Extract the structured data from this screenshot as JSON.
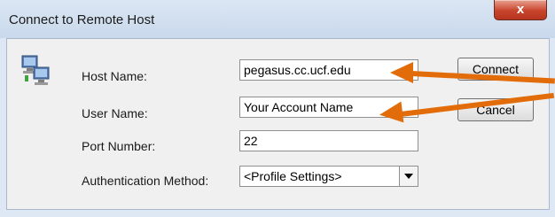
{
  "window": {
    "title": "Connect to Remote Host",
    "ghost_text": "",
    "close_label": "x"
  },
  "form": {
    "host_label": "Host Name:",
    "host_value": "pegasus.cc.ucf.edu",
    "user_label": "User Name:",
    "user_value": "Your Account Name",
    "port_label": "Port Number:",
    "port_value": "22",
    "auth_label": "Authentication Method:",
    "auth_value": "<Profile Settings>"
  },
  "buttons": {
    "connect_label": "Connect",
    "cancel_label": "Cancel"
  },
  "icons": [
    "computer-network-icon",
    "close-icon",
    "chevron-down-icon"
  ],
  "colors": {
    "annotation_arrow": "#e36c0a",
    "close_button": "#c8442c",
    "titlebar": "#dbe6f3"
  }
}
